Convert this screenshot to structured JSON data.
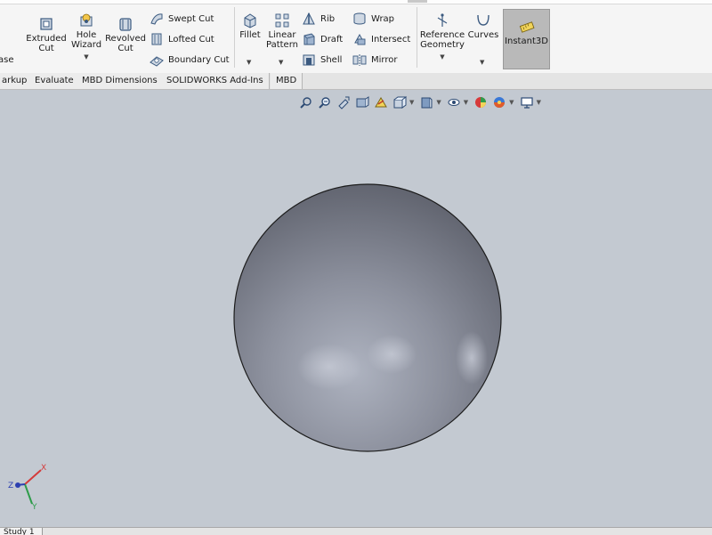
{
  "ribbon": {
    "partial_left_label": "ase",
    "extruded_cut": [
      "Extruded",
      "Cut"
    ],
    "hole_wizard": [
      "Hole",
      "Wizard"
    ],
    "revolved_cut": [
      "Revolved",
      "Cut"
    ],
    "swept_cut": "Swept Cut",
    "lofted_cut": "Lofted Cut",
    "boundary_cut": "Boundary Cut",
    "fillet": "Fillet",
    "linear_pattern": [
      "Linear",
      "Pattern"
    ],
    "rib": "Rib",
    "draft": "Draft",
    "shell": "Shell",
    "wrap": "Wrap",
    "intersect": "Intersect",
    "mirror": "Mirror",
    "reference_geometry": [
      "Reference",
      "Geometry"
    ],
    "curves": "Curves",
    "instant3d": "Instant3D"
  },
  "tabs": [
    "arkup",
    "Evaluate",
    "MBD Dimensions",
    "SOLIDWORKS Add-Ins",
    "MBD"
  ],
  "bottom_tab": "Study 1",
  "triad": {
    "x": "X",
    "y": "Y",
    "z": "Z"
  },
  "colors": {
    "viewport": "#c3c9d1",
    "ribbon": "#f5f5f5",
    "instant_active": "#b9b9b9"
  }
}
